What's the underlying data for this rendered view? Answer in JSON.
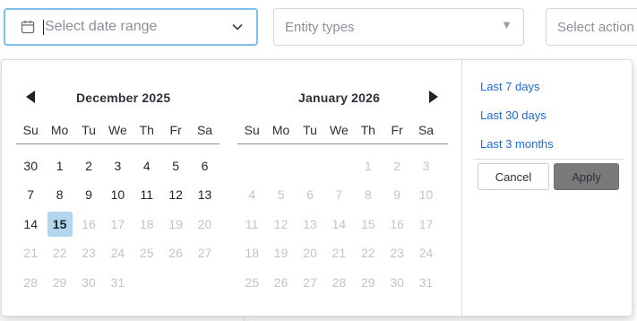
{
  "filters": {
    "date_range_placeholder": "Select date range",
    "entity_types_placeholder": "Entity types",
    "action_placeholder": "Select action"
  },
  "calendar": {
    "left": {
      "title": "December 2025",
      "weekdays": [
        "Su",
        "Mo",
        "Tu",
        "We",
        "Th",
        "Fr",
        "Sa"
      ],
      "weeks": [
        [
          {
            "d": "30",
            "s": "n"
          },
          {
            "d": "1",
            "s": "n"
          },
          {
            "d": "2",
            "s": "n"
          },
          {
            "d": "3",
            "s": "n"
          },
          {
            "d": "4",
            "s": "n"
          },
          {
            "d": "5",
            "s": "n"
          },
          {
            "d": "6",
            "s": "n"
          }
        ],
        [
          {
            "d": "7",
            "s": "n"
          },
          {
            "d": "8",
            "s": "n"
          },
          {
            "d": "9",
            "s": "n"
          },
          {
            "d": "10",
            "s": "n"
          },
          {
            "d": "11",
            "s": "n"
          },
          {
            "d": "12",
            "s": "n"
          },
          {
            "d": "13",
            "s": "n"
          }
        ],
        [
          {
            "d": "14",
            "s": "n"
          },
          {
            "d": "15",
            "s": "today"
          },
          {
            "d": "16",
            "s": "m"
          },
          {
            "d": "17",
            "s": "m"
          },
          {
            "d": "18",
            "s": "m"
          },
          {
            "d": "19",
            "s": "m"
          },
          {
            "d": "20",
            "s": "m"
          }
        ],
        [
          {
            "d": "21",
            "s": "m"
          },
          {
            "d": "22",
            "s": "m"
          },
          {
            "d": "23",
            "s": "m"
          },
          {
            "d": "24",
            "s": "m"
          },
          {
            "d": "25",
            "s": "m"
          },
          {
            "d": "26",
            "s": "m"
          },
          {
            "d": "27",
            "s": "m"
          }
        ],
        [
          {
            "d": "28",
            "s": "m"
          },
          {
            "d": "29",
            "s": "m"
          },
          {
            "d": "30",
            "s": "m"
          },
          {
            "d": "31",
            "s": "m"
          },
          {
            "d": "",
            "s": "b"
          },
          {
            "d": "",
            "s": "b"
          },
          {
            "d": "",
            "s": "b"
          }
        ]
      ]
    },
    "right": {
      "title": "January 2026",
      "weekdays": [
        "Su",
        "Mo",
        "Tu",
        "We",
        "Th",
        "Fr",
        "Sa"
      ],
      "weeks": [
        [
          {
            "d": "",
            "s": "b"
          },
          {
            "d": "",
            "s": "b"
          },
          {
            "d": "",
            "s": "b"
          },
          {
            "d": "",
            "s": "b"
          },
          {
            "d": "1",
            "s": "m"
          },
          {
            "d": "2",
            "s": "m"
          },
          {
            "d": "3",
            "s": "m"
          }
        ],
        [
          {
            "d": "4",
            "s": "m"
          },
          {
            "d": "5",
            "s": "m"
          },
          {
            "d": "6",
            "s": "m"
          },
          {
            "d": "7",
            "s": "m"
          },
          {
            "d": "8",
            "s": "m"
          },
          {
            "d": "9",
            "s": "m"
          },
          {
            "d": "10",
            "s": "m"
          }
        ],
        [
          {
            "d": "11",
            "s": "m"
          },
          {
            "d": "12",
            "s": "m"
          },
          {
            "d": "13",
            "s": "m"
          },
          {
            "d": "14",
            "s": "m"
          },
          {
            "d": "15",
            "s": "m"
          },
          {
            "d": "16",
            "s": "m"
          },
          {
            "d": "17",
            "s": "m"
          }
        ],
        [
          {
            "d": "18",
            "s": "m"
          },
          {
            "d": "19",
            "s": "m"
          },
          {
            "d": "20",
            "s": "m"
          },
          {
            "d": "21",
            "s": "m"
          },
          {
            "d": "22",
            "s": "m"
          },
          {
            "d": "23",
            "s": "m"
          },
          {
            "d": "24",
            "s": "m"
          }
        ],
        [
          {
            "d": "25",
            "s": "m"
          },
          {
            "d": "26",
            "s": "m"
          },
          {
            "d": "27",
            "s": "m"
          },
          {
            "d": "28",
            "s": "m"
          },
          {
            "d": "29",
            "s": "m"
          },
          {
            "d": "30",
            "s": "m"
          },
          {
            "d": "31",
            "s": "m"
          }
        ]
      ]
    }
  },
  "presets": [
    "Last 7 days",
    "Last 30 days",
    "Last 3 months"
  ],
  "buttons": {
    "cancel": "Cancel",
    "apply": "Apply"
  },
  "icons": {
    "date_field": "calendar-icon",
    "date_dropdown": "chevron-down-icon",
    "entity_dropdown": "triangle-down-icon",
    "prev": "left-triangle-icon",
    "next": "right-triangle-icon"
  },
  "colors": {
    "focus_border": "#7cc0ec",
    "today_highlight": "#b3d6f0",
    "preset_link": "#1e6bd0",
    "apply_button": "#7a7a7a"
  }
}
